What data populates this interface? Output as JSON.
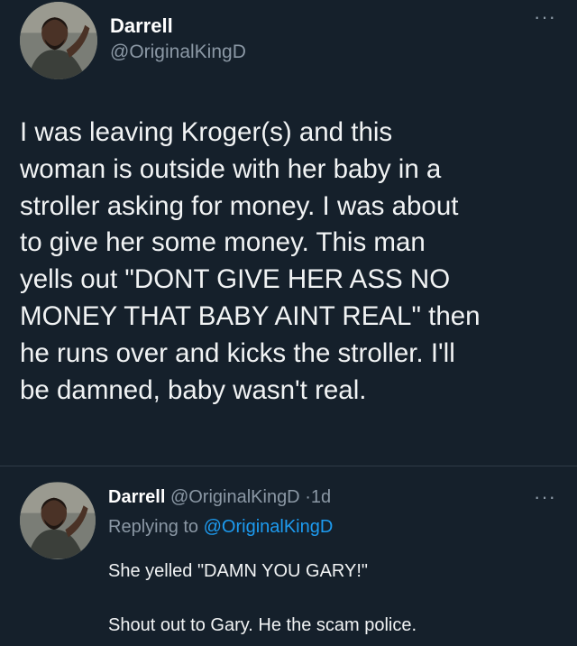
{
  "tweet": {
    "author_name": "Darrell",
    "author_handle": "@OriginalKingD",
    "more_icon": "···",
    "text": "I was leaving Kroger(s) and this\nwoman is outside with her baby in a\nstroller asking for money. I was about\nto give her some money. This man\nyells out \"DONT GIVE HER ASS NO\nMONEY THAT BABY AINT REAL\" then\nhe runs over and kicks the stroller. I'll\nbe damned, baby wasn't real."
  },
  "reply": {
    "author_name": "Darrell",
    "author_handle": "@OriginalKingD",
    "separator": "·",
    "time": "1d",
    "replying_prefix": "Replying to",
    "replying_to": "@OriginalKingD",
    "more_icon": "···",
    "line1": "She yelled \"DAMN YOU GARY!\"",
    "line2": "Shout out to Gary. He the scam police."
  },
  "colors": {
    "background": "#15202b",
    "text": "#e7e9ea",
    "secondary": "#8b98a5",
    "accent": "#1d9bf0"
  }
}
